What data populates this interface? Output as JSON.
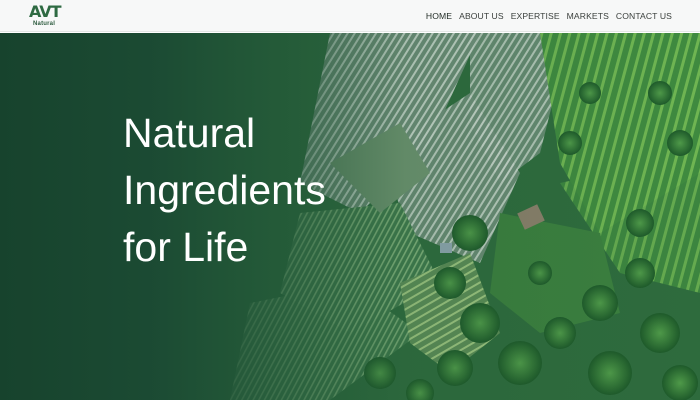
{
  "brand": {
    "logo_text": "AVT",
    "logo_subtext": "Natural",
    "accent_color": "#2e6a42"
  },
  "nav": {
    "items": [
      {
        "label": "HOME",
        "active": true
      },
      {
        "label": "ABOUT US",
        "active": false
      },
      {
        "label": "EXPERTISE",
        "active": false
      },
      {
        "label": "MARKETS",
        "active": false
      },
      {
        "label": "CONTACT US",
        "active": false
      }
    ]
  },
  "hero": {
    "title_line1": "Natural",
    "title_line2": "Ingredients",
    "title_line3": "for Life",
    "background": "aerial-farmland-image",
    "overlay_color": "#1b4a33"
  }
}
